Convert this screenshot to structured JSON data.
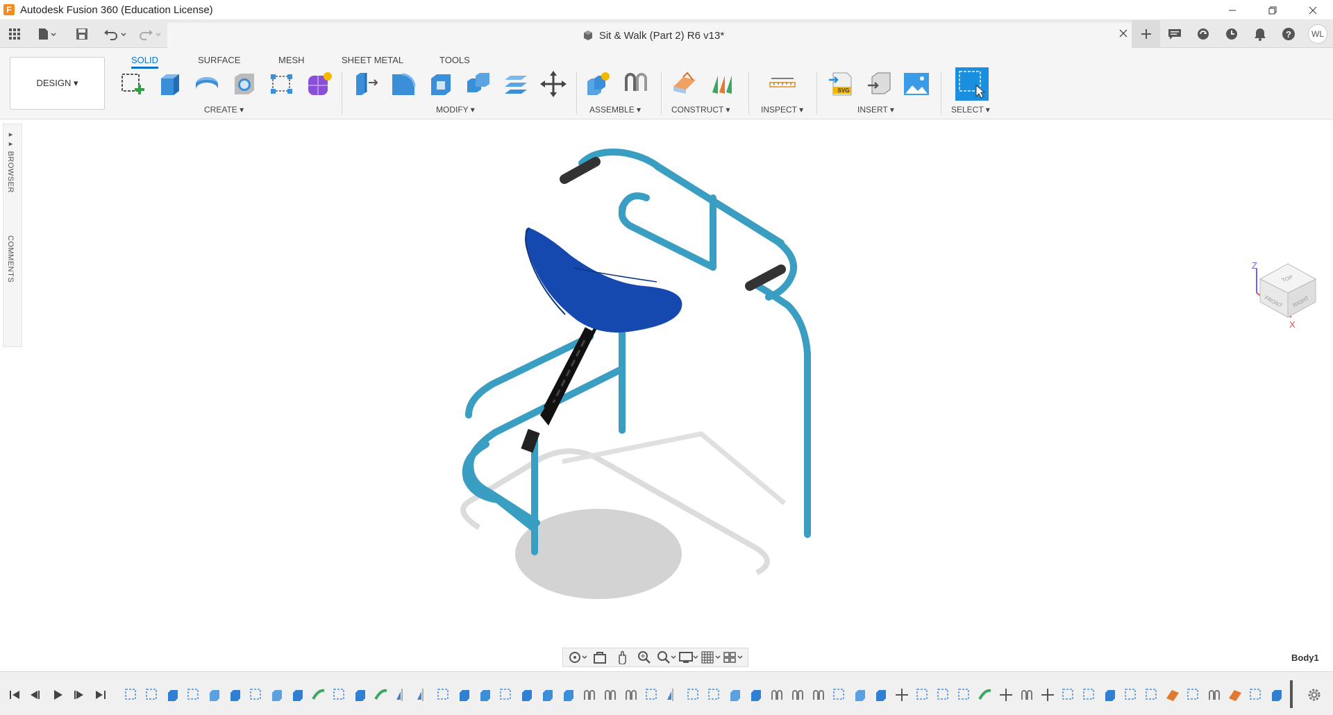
{
  "window": {
    "title": "Autodesk Fusion 360 (Education License)",
    "logo_letter": "F"
  },
  "document": {
    "tab_title": "Sit & Walk (Part 2) R6 v13*"
  },
  "user": {
    "initials": "WL"
  },
  "workspace": {
    "label": "DESIGN ▾"
  },
  "ribbon": {
    "tabs": [
      "SOLID",
      "SURFACE",
      "MESH",
      "SHEET METAL",
      "TOOLS"
    ],
    "active_tab": "SOLID",
    "groups": {
      "create": "CREATE ▾",
      "modify": "MODIFY ▾",
      "assemble": "ASSEMBLE ▾",
      "construct": "CONSTRUCT ▾",
      "inspect": "INSPECT ▾",
      "insert": "INSERT ▾",
      "select": "SELECT ▾"
    }
  },
  "side_panel": {
    "browser": "BROWSER",
    "comments": "COMMENTS"
  },
  "viewcube": {
    "top": "TOP",
    "front": "FRONT",
    "right": "RIGHT",
    "axis_z": "Z",
    "axis_x": "X"
  },
  "status": {
    "selection": "Body1"
  },
  "colors": {
    "accent": "#0a74c9",
    "tube": "#3a9ec2",
    "seat": "#1549b0",
    "grip": "#333333"
  }
}
